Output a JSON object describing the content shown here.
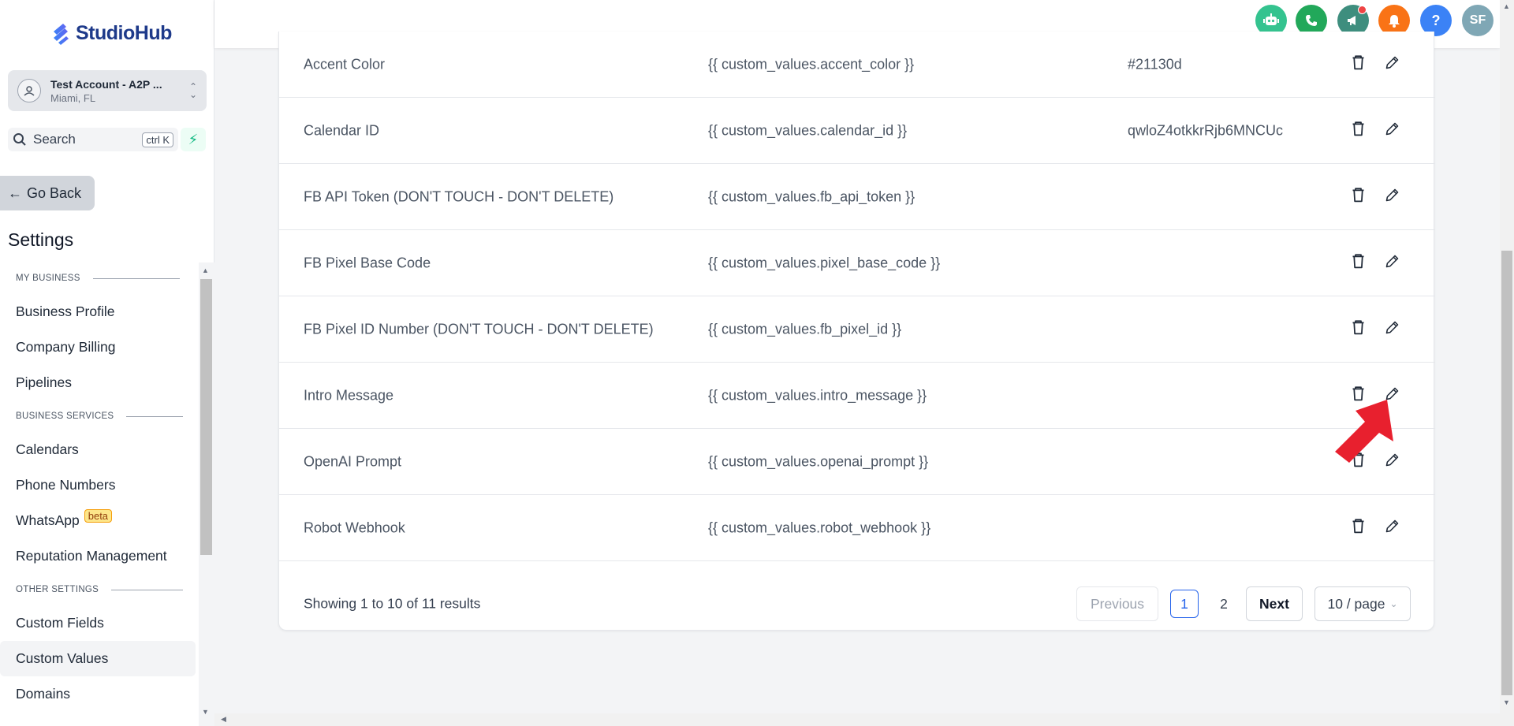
{
  "brand": {
    "name": "StudioHub",
    "colors": {
      "primary": "#2563eb",
      "accent": "#10b981"
    }
  },
  "account": {
    "name": "Test Account - A2P ...",
    "location": "Miami, FL"
  },
  "search": {
    "label": "Search",
    "shortcut": "ctrl K"
  },
  "nav": {
    "go_back": "Go Back",
    "settings_title": "Settings",
    "sections": [
      {
        "title": "MY BUSINESS",
        "items": [
          "Business Profile",
          "Company Billing",
          "Pipelines"
        ]
      },
      {
        "title": "BUSINESS SERVICES",
        "items": [
          "Calendars",
          "Phone Numbers",
          "WhatsApp",
          "Reputation Management"
        ]
      },
      {
        "title": "OTHER SETTINGS",
        "items": [
          "Custom Fields",
          "Custom Values",
          "Domains"
        ]
      }
    ],
    "beta_badge": "beta",
    "active_item": "Custom Values"
  },
  "header": {
    "icons": [
      {
        "name": "robot-icon",
        "color": "#34c38f"
      },
      {
        "name": "phone-icon",
        "color": "#22a85a"
      },
      {
        "name": "megaphone-icon",
        "color": "#3e8e7e"
      },
      {
        "name": "bell-icon",
        "color": "#f97316"
      },
      {
        "name": "help-icon",
        "color": "#3b82f6",
        "glyph": "?"
      },
      {
        "name": "user-avatar",
        "color": "#7fa7b5",
        "glyph": "SF"
      }
    ]
  },
  "table": {
    "rows": [
      {
        "name": "Accent Color",
        "key": "{{ custom_values.accent_color }}",
        "value": "#21130d"
      },
      {
        "name": "Calendar ID",
        "key": "{{ custom_values.calendar_id }}",
        "value": "qwloZ4otkkrRjb6MNCUc"
      },
      {
        "name": "FB API Token (DON'T TOUCH - DON'T DELETE)",
        "key": "{{ custom_values.fb_api_token }}",
        "value": ""
      },
      {
        "name": "FB Pixel Base Code",
        "key": "{{ custom_values.pixel_base_code }}",
        "value": ""
      },
      {
        "name": "FB Pixel ID Number (DON'T TOUCH - DON'T DELETE)",
        "key": "{{ custom_values.fb_pixel_id }}",
        "value": ""
      },
      {
        "name": "Intro Message",
        "key": "{{ custom_values.intro_message }}",
        "value": ""
      },
      {
        "name": "OpenAI Prompt",
        "key": "{{ custom_values.openai_prompt }}",
        "value": ""
      },
      {
        "name": "Robot Webhook",
        "key": "{{ custom_values.robot_webhook }}",
        "value": ""
      }
    ]
  },
  "pagination": {
    "showing": "Showing 1 to 10 of 11 results",
    "previous": "Previous",
    "pages": [
      "1",
      "2"
    ],
    "current_page": "1",
    "next": "Next",
    "per_page": "10 / page"
  }
}
